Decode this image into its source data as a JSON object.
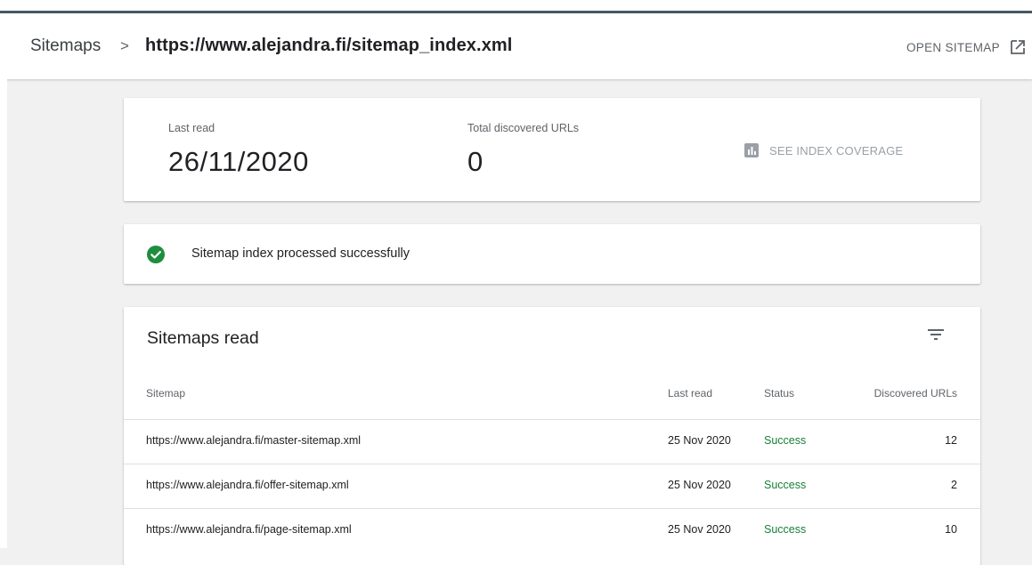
{
  "header": {
    "breadcrumb_root": "Sitemaps",
    "breadcrumb_separator": ">",
    "breadcrumb_current": "https://www.alejandra.fi/sitemap_index.xml",
    "open_sitemap_label": "OPEN SITEMAP",
    "open_icon": "open-in-new-icon",
    "accent_color": "#455a64"
  },
  "stats": {
    "last_read_label": "Last read",
    "last_read_value": "26/11/2020",
    "total_urls_label": "Total discovered URLs",
    "total_urls_value": "0",
    "coverage_link_label": "SEE INDEX COVERAGE",
    "coverage_icon": "bar-chart-icon"
  },
  "status": {
    "icon": "check-circle-icon",
    "color": "#1e8e3e",
    "text": "Sitemap index processed successfully"
  },
  "table": {
    "title": "Sitemaps read",
    "filter_icon": "filter-icon",
    "columns": {
      "sitemap": "Sitemap",
      "last_read": "Last read",
      "status": "Status",
      "discovered": "Discovered URLs"
    },
    "rows": [
      {
        "sitemap": "https://www.alejandra.fi/master-sitemap.xml",
        "last_read": "25 Nov 2020",
        "status": "Success",
        "discovered": "12"
      },
      {
        "sitemap": "https://www.alejandra.fi/offer-sitemap.xml",
        "last_read": "25 Nov 2020",
        "status": "Success",
        "discovered": "2"
      },
      {
        "sitemap": "https://www.alejandra.fi/page-sitemap.xml",
        "last_read": "25 Nov 2020",
        "status": "Success",
        "discovered": "10"
      }
    ],
    "success_color": "#188038"
  }
}
